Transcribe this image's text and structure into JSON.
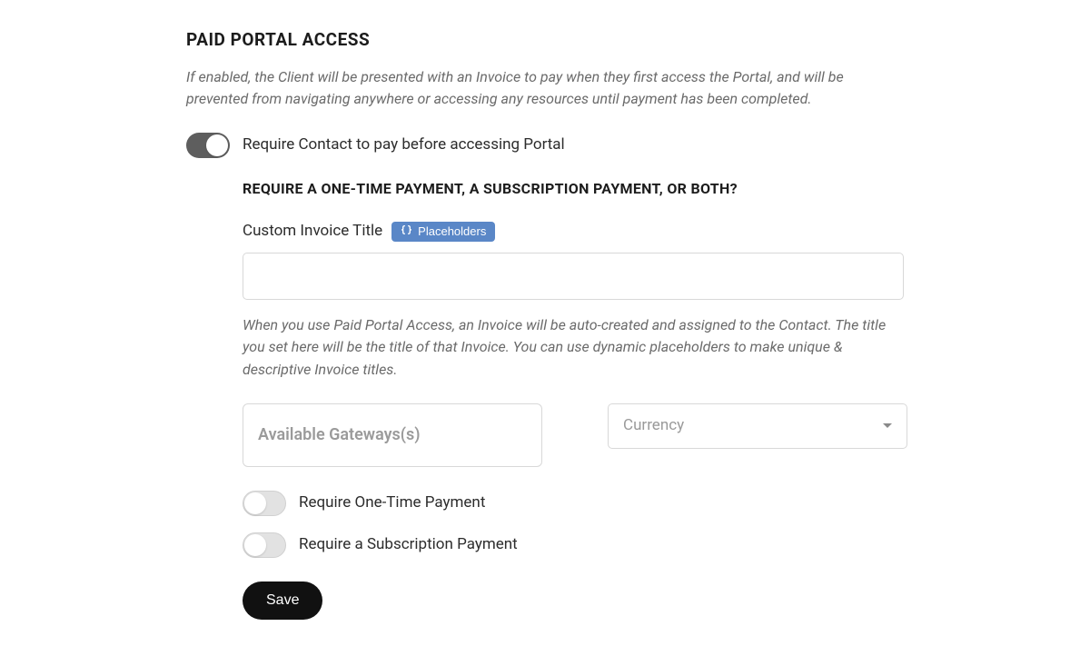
{
  "section": {
    "title": "PAID PORTAL ACCESS",
    "description": "If enabled, the Client will be presented with an Invoice to pay when they first access the Portal, and will be prevented from navigating anywhere or accessing any resources until payment has been completed."
  },
  "mainToggle": {
    "label": "Require Contact to pay before accessing Portal"
  },
  "subHeading": "REQUIRE A ONE-TIME PAYMENT, A SUBSCRIPTION PAYMENT, OR BOTH?",
  "invoiceTitle": {
    "label": "Custom Invoice Title",
    "placeholdersBtn": "Placeholders",
    "value": "",
    "help": "When you use Paid Portal Access, an Invoice will be auto-created and assigned to the Contact. The title you set here will be the title of that Invoice. You can use dynamic placeholders to make unique & descriptive Invoice titles."
  },
  "gateways": {
    "placeholder": "Available Gateways(s)"
  },
  "currency": {
    "placeholder": "Currency"
  },
  "options": {
    "oneTime": "Require One-Time Payment",
    "subscription": "Require a Subscription Payment"
  },
  "saveBtn": "Save"
}
